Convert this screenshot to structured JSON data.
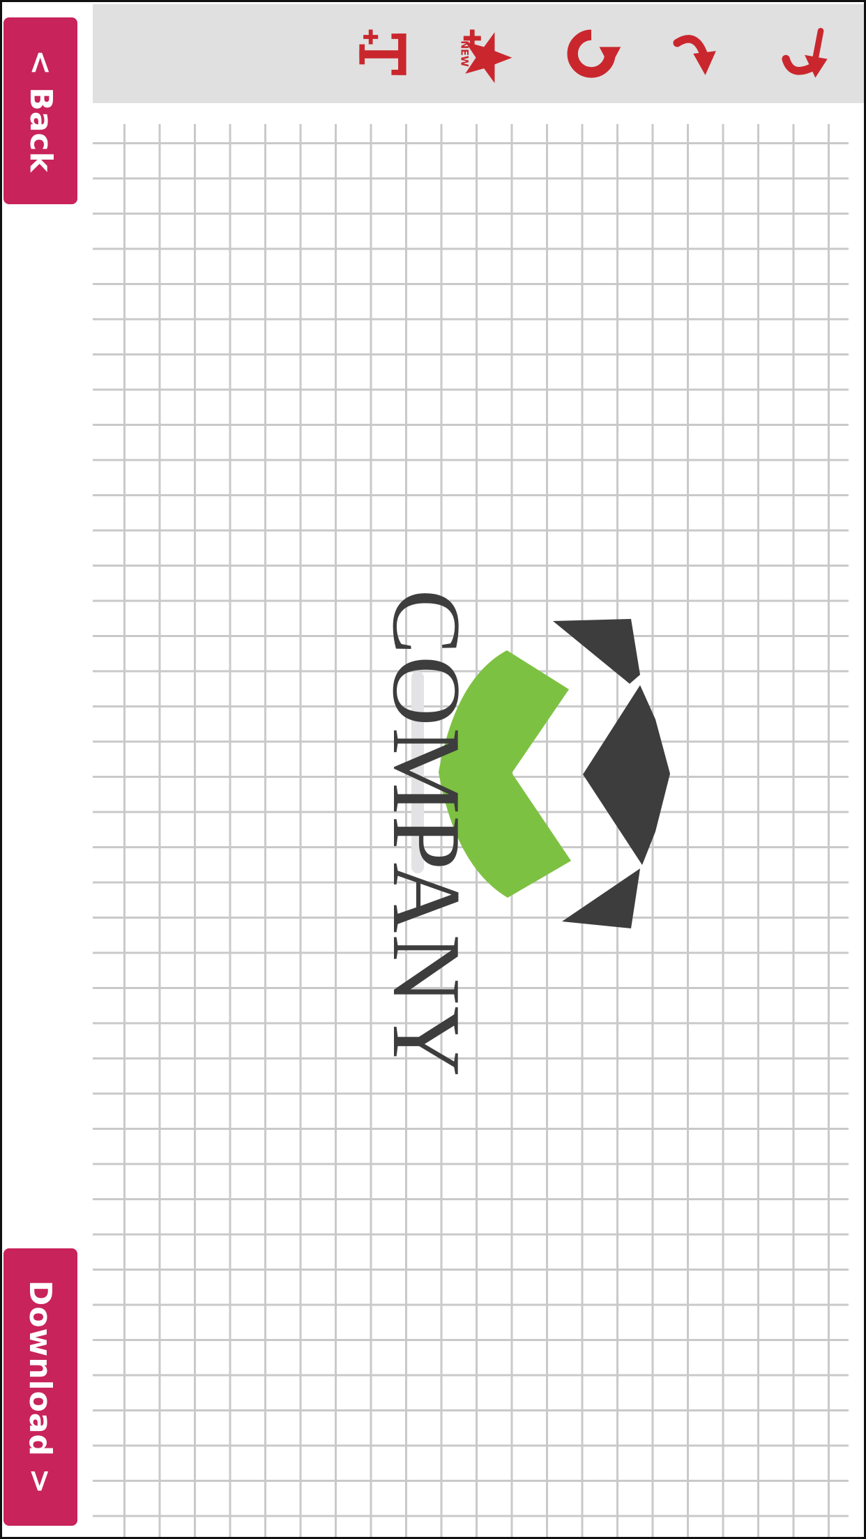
{
  "nav": {
    "back_label": "< Back",
    "download_label": "Download >"
  },
  "toolbar": {
    "tools": [
      {
        "name": "add-text-icon",
        "label": ""
      },
      {
        "name": "add-clipart-icon",
        "badge": "NEW"
      },
      {
        "name": "rotate-icon"
      },
      {
        "name": "redo-icon"
      },
      {
        "name": "undo-icon"
      }
    ]
  },
  "canvas": {
    "logo_text": "COMPANY"
  },
  "colors": {
    "accent": "#c8235a",
    "icon_red": "#c9272d",
    "toolbar_bg": "#e0e0e0",
    "grid_line": "#c9c9c9",
    "logo_green": "#7dc142",
    "logo_dark": "#3d3d3d",
    "logo_text": "#3d3d3d"
  }
}
